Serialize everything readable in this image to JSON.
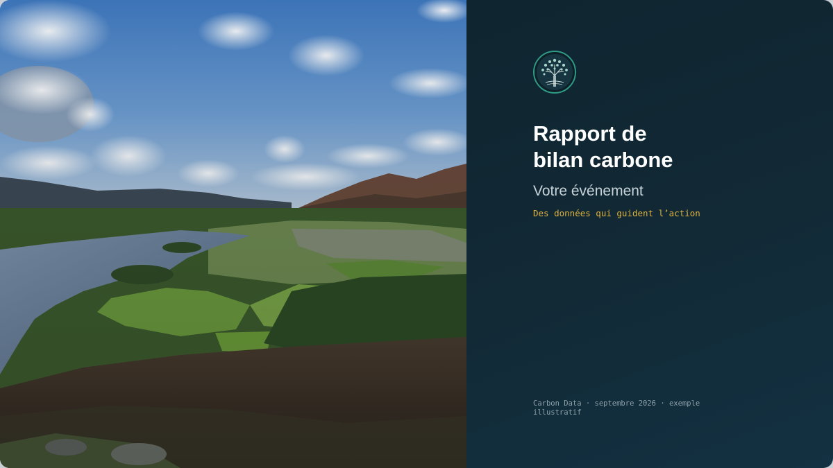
{
  "slide": {
    "title_line1": "Rapport de",
    "title_line2": "bilan carbone",
    "subtitle": "Votre événement",
    "tagline": "Des données qui guident l’action",
    "footer": "Carbon Data · septembre 2026 · exemple illustratif",
    "logo_icon": "tree-logo-icon",
    "photo_icon": "landscape-photo-icon"
  },
  "colors": {
    "panel_background": "#122a36",
    "title": "#ffffff",
    "subtitle": "#c6d3d9",
    "tagline": "#e0b23e",
    "footer": "#8ea1aa",
    "logo_ring": "#2f9a86"
  }
}
